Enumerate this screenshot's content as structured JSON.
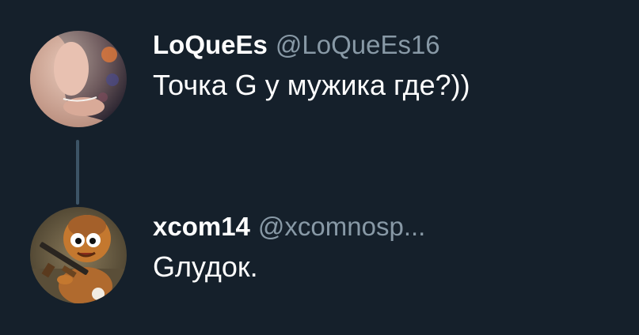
{
  "theme": {
    "background": "#15202b",
    "text_primary": "#ffffff",
    "text_secondary": "#8899a6",
    "thread_line": "#3d5466"
  },
  "tweets": [
    {
      "display_name": "LoQueEs",
      "handle": "@LoQueEs16",
      "text": "Точка G  у мужика где?))",
      "avatar": "photo-avatar"
    },
    {
      "display_name": "xcom14",
      "handle": "@xcomnosp...",
      "text": "Gлудок.",
      "avatar": "cartoon-character-avatar"
    }
  ]
}
